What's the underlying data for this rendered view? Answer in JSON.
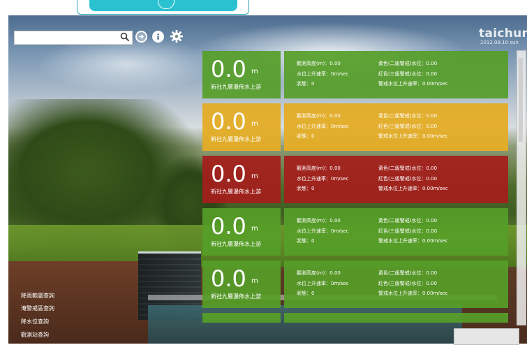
{
  "header": {
    "brand": "taichung",
    "date": "2012.09.10 sun"
  },
  "search": {
    "value": "",
    "placeholder": ""
  },
  "icons": {
    "search": "search-icon",
    "arrow": "arrow-right-circle-icon",
    "info": "info-icon",
    "settings": "gear-icon"
  },
  "colors": {
    "normal": "#569e28",
    "warning": "#e4ac24",
    "alert": "#a51e1c",
    "accent": "#2ac2d1"
  },
  "labels": {
    "l1": "觀測高度(m)：0.00",
    "l2": "水位上升速率：0m/sec",
    "l3": "狀態：0",
    "l4": "黃色(二級警戒)水位：0.00",
    "l5": "紅色(三級警戒)水位：0.00",
    "l6": "警戒水位上升速率：0.00m/sec"
  },
  "stations": [
    {
      "value": "0.0",
      "unit": "m",
      "name": "新社九層瀑佈水上游",
      "status": "normal"
    },
    {
      "value": "0.0",
      "unit": "m",
      "name": "新社九層瀑佈水上游",
      "status": "warning"
    },
    {
      "value": "0.0",
      "unit": "m",
      "name": "新社九層瀑佈水上游",
      "status": "alert"
    },
    {
      "value": "0.0",
      "unit": "m",
      "name": "新社九層瀑佈水上游",
      "status": "normal"
    },
    {
      "value": "0.0",
      "unit": "m",
      "name": "新社九層瀑佈水上游",
      "status": "normal"
    }
  ],
  "sidebar": {
    "items": [
      {
        "label": "降雨範圍查詢"
      },
      {
        "label": "淹警戒區查詢"
      },
      {
        "label": "降水位查詢"
      },
      {
        "label": "觀測站查詢"
      }
    ]
  }
}
